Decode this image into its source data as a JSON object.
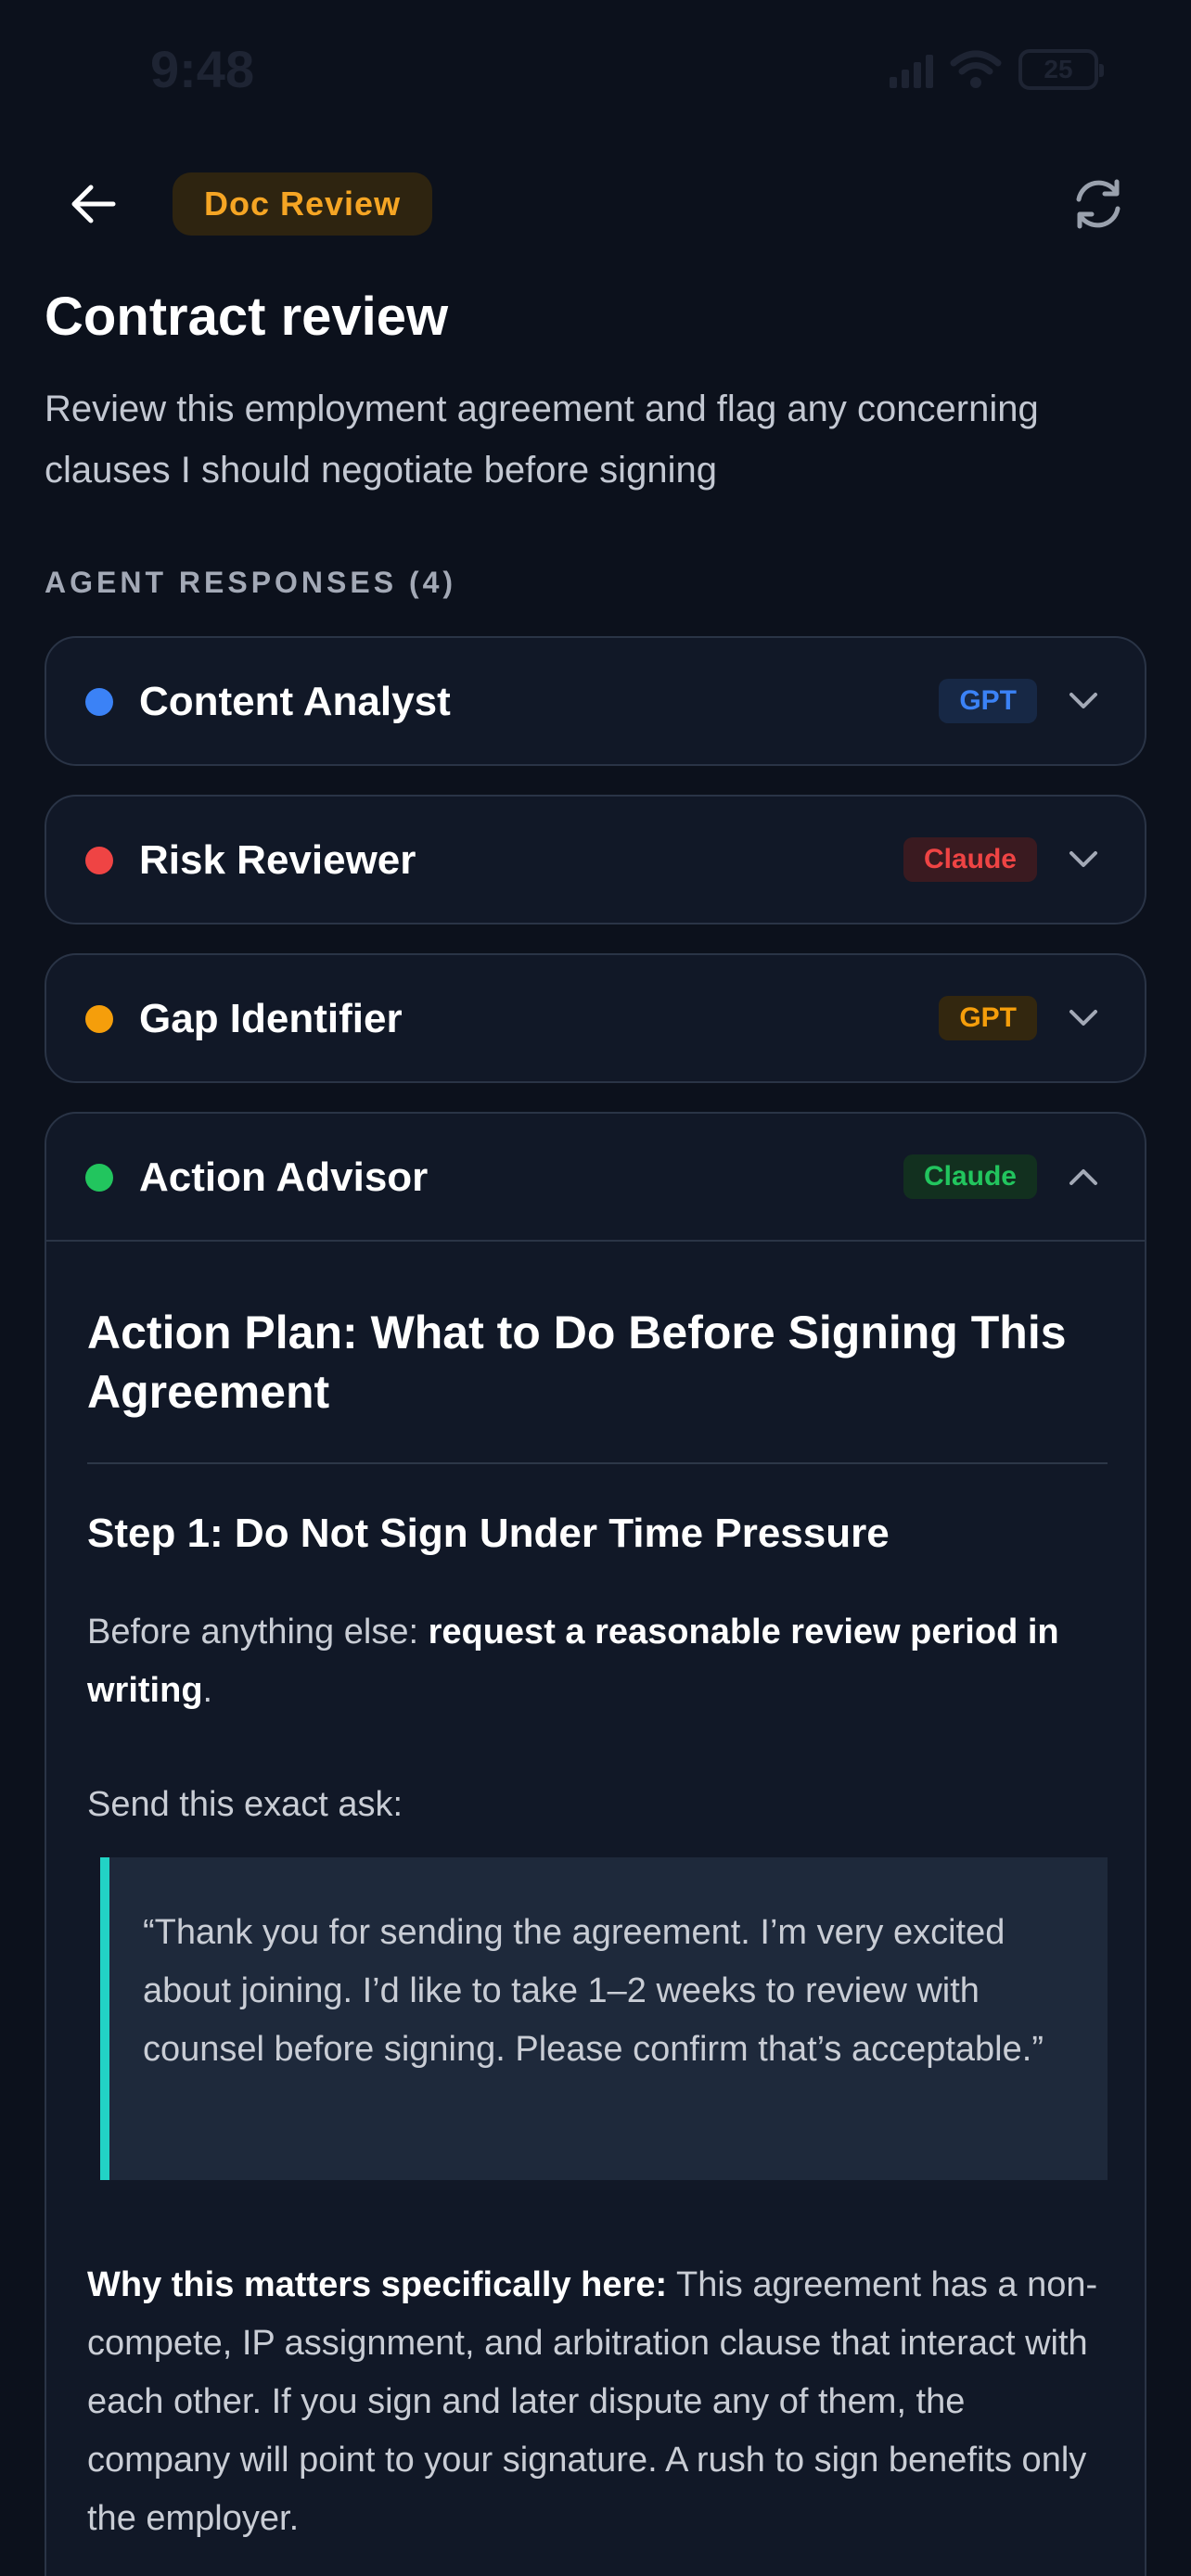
{
  "status_bar": {
    "time": "9:48",
    "battery": "25"
  },
  "header": {
    "badge": "Doc Review"
  },
  "page": {
    "title": "Contract review",
    "subtitle": "Review this employment agreement and flag any concerning clauses I should negotiate before signing"
  },
  "section": {
    "label": "AGENT RESPONSES (4)"
  },
  "agents": [
    {
      "name": "Content Analyst",
      "model": "GPT",
      "dot_color": "#3b82f6",
      "tag_bg": "#172845",
      "tag_color": "#3b82f6",
      "expanded": false
    },
    {
      "name": "Risk Reviewer",
      "model": "Claude",
      "dot_color": "#ef4444",
      "tag_bg": "#3a1a20",
      "tag_color": "#ef4444",
      "expanded": false
    },
    {
      "name": "Gap Identifier",
      "model": "GPT",
      "dot_color": "#f59e0b",
      "tag_bg": "#33270f",
      "tag_color": "#f59e0b",
      "expanded": false
    },
    {
      "name": "Action Advisor",
      "model": "Claude",
      "dot_color": "#22c55e",
      "tag_bg": "#12301f",
      "tag_color": "#22c55e",
      "expanded": true
    }
  ],
  "response": {
    "heading": "Action Plan: What to Do Before Signing This Agreement",
    "step1_title": "Step 1: Do Not Sign Under Time Pressure",
    "p1_lead": "Before anything else: ",
    "p1_bold": "request a reasonable review period in writing",
    "p1_tail": ".",
    "p2": "Send this exact ask:",
    "quote": "“Thank you for sending the agreement. I’m very excited about joining. I’d like to take 1–2 weeks to review with counsel before signing. Please confirm that’s acceptable.”",
    "p3_bold": "Why this matters specifically here:",
    "p3_text": " This agreement has a non-compete, IP assignment, and arbitration clause that interact with each other. If you sign and later dispute any of them, the company will point to your signature. A rush to sign benefits only the employer."
  }
}
